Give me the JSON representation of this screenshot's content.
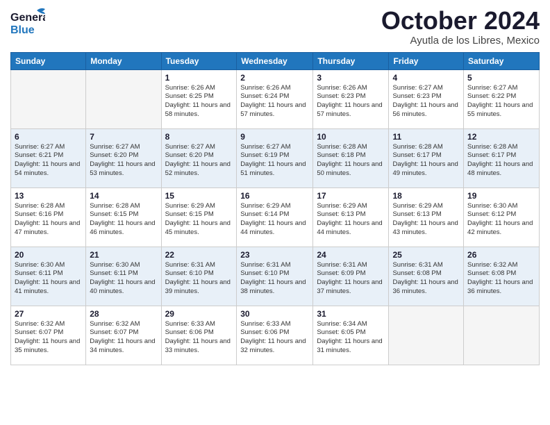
{
  "header": {
    "logo_general": "General",
    "logo_blue": "Blue",
    "month": "October 2024",
    "location": "Ayutla de los Libres, Mexico"
  },
  "weekdays": [
    "Sunday",
    "Monday",
    "Tuesday",
    "Wednesday",
    "Thursday",
    "Friday",
    "Saturday"
  ],
  "weeks": [
    [
      {
        "day": "",
        "empty": true
      },
      {
        "day": "",
        "empty": true
      },
      {
        "day": "1",
        "sunrise": "6:26 AM",
        "sunset": "6:25 PM",
        "daylight": "11 hours and 58 minutes."
      },
      {
        "day": "2",
        "sunrise": "6:26 AM",
        "sunset": "6:24 PM",
        "daylight": "11 hours and 57 minutes."
      },
      {
        "day": "3",
        "sunrise": "6:26 AM",
        "sunset": "6:23 PM",
        "daylight": "11 hours and 57 minutes."
      },
      {
        "day": "4",
        "sunrise": "6:27 AM",
        "sunset": "6:23 PM",
        "daylight": "11 hours and 56 minutes."
      },
      {
        "day": "5",
        "sunrise": "6:27 AM",
        "sunset": "6:22 PM",
        "daylight": "11 hours and 55 minutes."
      }
    ],
    [
      {
        "day": "6",
        "sunrise": "6:27 AM",
        "sunset": "6:21 PM",
        "daylight": "11 hours and 54 minutes."
      },
      {
        "day": "7",
        "sunrise": "6:27 AM",
        "sunset": "6:20 PM",
        "daylight": "11 hours and 53 minutes."
      },
      {
        "day": "8",
        "sunrise": "6:27 AM",
        "sunset": "6:20 PM",
        "daylight": "11 hours and 52 minutes."
      },
      {
        "day": "9",
        "sunrise": "6:27 AM",
        "sunset": "6:19 PM",
        "daylight": "11 hours and 51 minutes."
      },
      {
        "day": "10",
        "sunrise": "6:28 AM",
        "sunset": "6:18 PM",
        "daylight": "11 hours and 50 minutes."
      },
      {
        "day": "11",
        "sunrise": "6:28 AM",
        "sunset": "6:17 PM",
        "daylight": "11 hours and 49 minutes."
      },
      {
        "day": "12",
        "sunrise": "6:28 AM",
        "sunset": "6:17 PM",
        "daylight": "11 hours and 48 minutes."
      }
    ],
    [
      {
        "day": "13",
        "sunrise": "6:28 AM",
        "sunset": "6:16 PM",
        "daylight": "11 hours and 47 minutes."
      },
      {
        "day": "14",
        "sunrise": "6:28 AM",
        "sunset": "6:15 PM",
        "daylight": "11 hours and 46 minutes."
      },
      {
        "day": "15",
        "sunrise": "6:29 AM",
        "sunset": "6:15 PM",
        "daylight": "11 hours and 45 minutes."
      },
      {
        "day": "16",
        "sunrise": "6:29 AM",
        "sunset": "6:14 PM",
        "daylight": "11 hours and 44 minutes."
      },
      {
        "day": "17",
        "sunrise": "6:29 AM",
        "sunset": "6:13 PM",
        "daylight": "11 hours and 44 minutes."
      },
      {
        "day": "18",
        "sunrise": "6:29 AM",
        "sunset": "6:13 PM",
        "daylight": "11 hours and 43 minutes."
      },
      {
        "day": "19",
        "sunrise": "6:30 AM",
        "sunset": "6:12 PM",
        "daylight": "11 hours and 42 minutes."
      }
    ],
    [
      {
        "day": "20",
        "sunrise": "6:30 AM",
        "sunset": "6:11 PM",
        "daylight": "11 hours and 41 minutes."
      },
      {
        "day": "21",
        "sunrise": "6:30 AM",
        "sunset": "6:11 PM",
        "daylight": "11 hours and 40 minutes."
      },
      {
        "day": "22",
        "sunrise": "6:31 AM",
        "sunset": "6:10 PM",
        "daylight": "11 hours and 39 minutes."
      },
      {
        "day": "23",
        "sunrise": "6:31 AM",
        "sunset": "6:10 PM",
        "daylight": "11 hours and 38 minutes."
      },
      {
        "day": "24",
        "sunrise": "6:31 AM",
        "sunset": "6:09 PM",
        "daylight": "11 hours and 37 minutes."
      },
      {
        "day": "25",
        "sunrise": "6:31 AM",
        "sunset": "6:08 PM",
        "daylight": "11 hours and 36 minutes."
      },
      {
        "day": "26",
        "sunrise": "6:32 AM",
        "sunset": "6:08 PM",
        "daylight": "11 hours and 36 minutes."
      }
    ],
    [
      {
        "day": "27",
        "sunrise": "6:32 AM",
        "sunset": "6:07 PM",
        "daylight": "11 hours and 35 minutes."
      },
      {
        "day": "28",
        "sunrise": "6:32 AM",
        "sunset": "6:07 PM",
        "daylight": "11 hours and 34 minutes."
      },
      {
        "day": "29",
        "sunrise": "6:33 AM",
        "sunset": "6:06 PM",
        "daylight": "11 hours and 33 minutes."
      },
      {
        "day": "30",
        "sunrise": "6:33 AM",
        "sunset": "6:06 PM",
        "daylight": "11 hours and 32 minutes."
      },
      {
        "day": "31",
        "sunrise": "6:34 AM",
        "sunset": "6:05 PM",
        "daylight": "11 hours and 31 minutes."
      },
      {
        "day": "",
        "empty": true
      },
      {
        "day": "",
        "empty": true
      }
    ]
  ]
}
